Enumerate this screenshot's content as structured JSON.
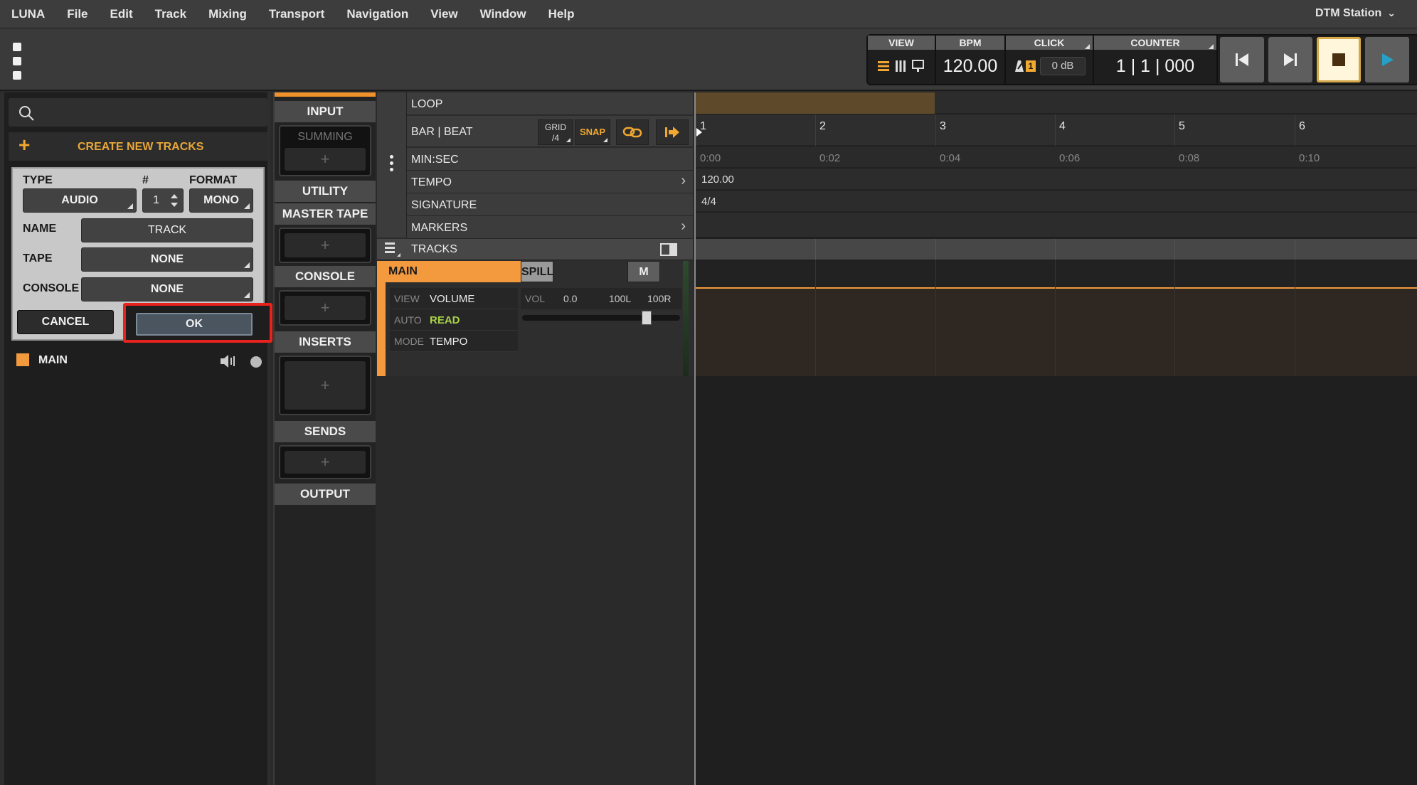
{
  "menubar": {
    "items": [
      "LUNA",
      "File",
      "Edit",
      "Track",
      "Mixing",
      "Transport",
      "Navigation",
      "View",
      "Window",
      "Help"
    ],
    "station": "DTM Station"
  },
  "transport": {
    "view_label": "VIEW",
    "bpm_label": "BPM",
    "bpm_value": "120.00",
    "click_label": "CLICK",
    "click_level": "0 dB",
    "click_badge": "1",
    "counter_label": "COUNTER",
    "counter_value": "1 | 1 | 000"
  },
  "create_tracks": {
    "header": "CREATE NEW TRACKS",
    "type_label": "TYPE",
    "count_label": "#",
    "format_label": "FORMAT",
    "type_value": "AUDIO",
    "count_value": "1",
    "format_value": "MONO",
    "name_label": "NAME",
    "name_value": "TRACK",
    "tape_label": "TAPE",
    "tape_value": "NONE",
    "console_label": "CONSOLE",
    "console_value": "NONE",
    "cancel_label": "CANCEL",
    "ok_label": "OK"
  },
  "track_list": [
    {
      "name": "MAIN",
      "color": "#f39a3e"
    }
  ],
  "strip": {
    "input": "INPUT",
    "summing": "SUMMING",
    "utility": "UTILITY",
    "master_tape": "MASTER TAPE",
    "console": "CONSOLE",
    "inserts": "INSERTS",
    "sends": "SENDS",
    "output": "OUTPUT",
    "plus": "+"
  },
  "rulers": {
    "loop": "LOOP",
    "bar_beat": "BAR | BEAT",
    "grid_label": "GRID",
    "grid_value": "/4",
    "snap": "SNAP",
    "min_sec": "MIN:SEC",
    "tempo": "TEMPO",
    "signature": "SIGNATURE",
    "markers": "MARKERS",
    "tracks": "TRACKS"
  },
  "main_track": {
    "name": "MAIN",
    "spill": "SPILL",
    "mute": "M",
    "view_key": "VIEW",
    "view_val": "VOLUME",
    "auto_key": "AUTO",
    "auto_val": "READ",
    "mode_key": "MODE",
    "mode_val": "TEMPO",
    "vol_key": "VOL",
    "vol_val": "0.0",
    "pan_l": "100L",
    "pan_r": "100R"
  },
  "timeline": {
    "bars": [
      "1",
      "2",
      "3",
      "4",
      "5",
      "6"
    ],
    "times": [
      "0:00",
      "0:02",
      "0:04",
      "0:06",
      "0:08",
      "0:10"
    ],
    "tempo_value": "120.00",
    "signature_value": "4/4"
  },
  "colors": {
    "accent_orange": "#f39a3e",
    "highlight_red": "#e8221c",
    "snap_yellow": "#f0a830",
    "auto_read_green": "#a9d24a"
  }
}
